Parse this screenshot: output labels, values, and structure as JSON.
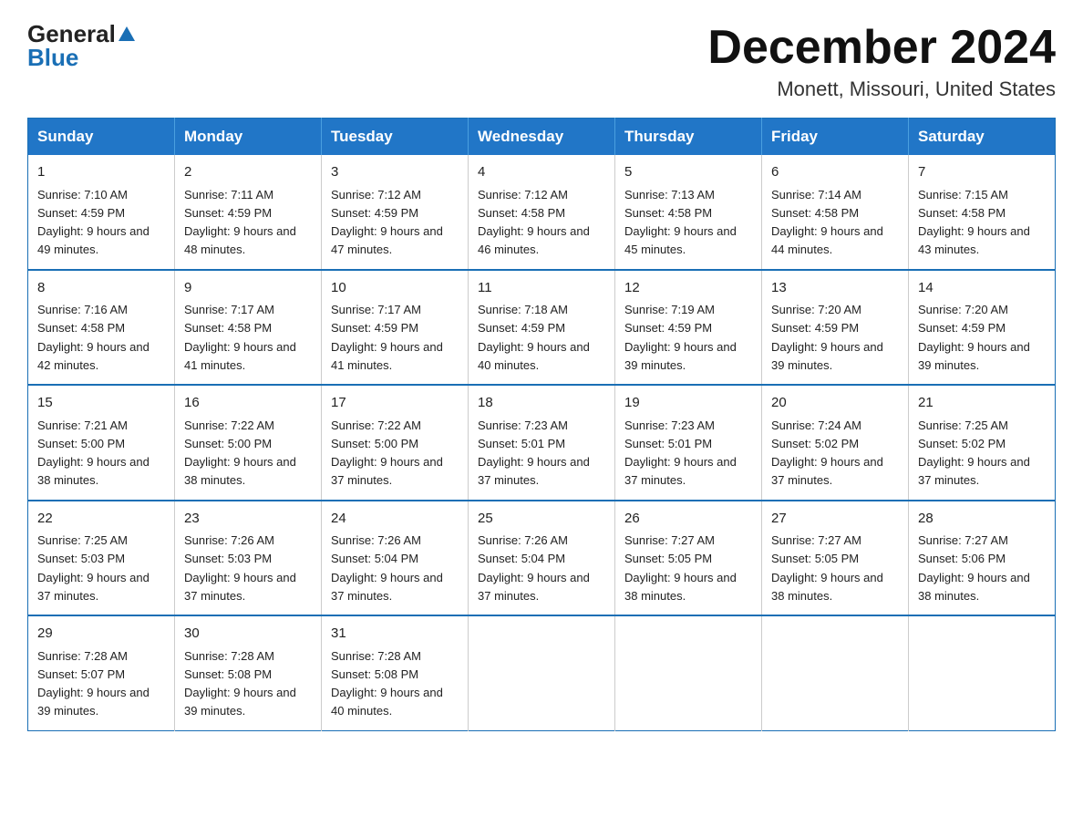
{
  "logo": {
    "general": "General",
    "blue": "Blue",
    "triangle": "▲"
  },
  "title": {
    "month_year": "December 2024",
    "location": "Monett, Missouri, United States"
  },
  "days_of_week": [
    "Sunday",
    "Monday",
    "Tuesday",
    "Wednesday",
    "Thursday",
    "Friday",
    "Saturday"
  ],
  "weeks": [
    [
      {
        "day": "1",
        "sunrise": "7:10 AM",
        "sunset": "4:59 PM",
        "daylight": "9 hours and 49 minutes."
      },
      {
        "day": "2",
        "sunrise": "7:11 AM",
        "sunset": "4:59 PM",
        "daylight": "9 hours and 48 minutes."
      },
      {
        "day": "3",
        "sunrise": "7:12 AM",
        "sunset": "4:59 PM",
        "daylight": "9 hours and 47 minutes."
      },
      {
        "day": "4",
        "sunrise": "7:12 AM",
        "sunset": "4:58 PM",
        "daylight": "9 hours and 46 minutes."
      },
      {
        "day": "5",
        "sunrise": "7:13 AM",
        "sunset": "4:58 PM",
        "daylight": "9 hours and 45 minutes."
      },
      {
        "day": "6",
        "sunrise": "7:14 AM",
        "sunset": "4:58 PM",
        "daylight": "9 hours and 44 minutes."
      },
      {
        "day": "7",
        "sunrise": "7:15 AM",
        "sunset": "4:58 PM",
        "daylight": "9 hours and 43 minutes."
      }
    ],
    [
      {
        "day": "8",
        "sunrise": "7:16 AM",
        "sunset": "4:58 PM",
        "daylight": "9 hours and 42 minutes."
      },
      {
        "day": "9",
        "sunrise": "7:17 AM",
        "sunset": "4:58 PM",
        "daylight": "9 hours and 41 minutes."
      },
      {
        "day": "10",
        "sunrise": "7:17 AM",
        "sunset": "4:59 PM",
        "daylight": "9 hours and 41 minutes."
      },
      {
        "day": "11",
        "sunrise": "7:18 AM",
        "sunset": "4:59 PM",
        "daylight": "9 hours and 40 minutes."
      },
      {
        "day": "12",
        "sunrise": "7:19 AM",
        "sunset": "4:59 PM",
        "daylight": "9 hours and 39 minutes."
      },
      {
        "day": "13",
        "sunrise": "7:20 AM",
        "sunset": "4:59 PM",
        "daylight": "9 hours and 39 minutes."
      },
      {
        "day": "14",
        "sunrise": "7:20 AM",
        "sunset": "4:59 PM",
        "daylight": "9 hours and 39 minutes."
      }
    ],
    [
      {
        "day": "15",
        "sunrise": "7:21 AM",
        "sunset": "5:00 PM",
        "daylight": "9 hours and 38 minutes."
      },
      {
        "day": "16",
        "sunrise": "7:22 AM",
        "sunset": "5:00 PM",
        "daylight": "9 hours and 38 minutes."
      },
      {
        "day": "17",
        "sunrise": "7:22 AM",
        "sunset": "5:00 PM",
        "daylight": "9 hours and 37 minutes."
      },
      {
        "day": "18",
        "sunrise": "7:23 AM",
        "sunset": "5:01 PM",
        "daylight": "9 hours and 37 minutes."
      },
      {
        "day": "19",
        "sunrise": "7:23 AM",
        "sunset": "5:01 PM",
        "daylight": "9 hours and 37 minutes."
      },
      {
        "day": "20",
        "sunrise": "7:24 AM",
        "sunset": "5:02 PM",
        "daylight": "9 hours and 37 minutes."
      },
      {
        "day": "21",
        "sunrise": "7:25 AM",
        "sunset": "5:02 PM",
        "daylight": "9 hours and 37 minutes."
      }
    ],
    [
      {
        "day": "22",
        "sunrise": "7:25 AM",
        "sunset": "5:03 PM",
        "daylight": "9 hours and 37 minutes."
      },
      {
        "day": "23",
        "sunrise": "7:26 AM",
        "sunset": "5:03 PM",
        "daylight": "9 hours and 37 minutes."
      },
      {
        "day": "24",
        "sunrise": "7:26 AM",
        "sunset": "5:04 PM",
        "daylight": "9 hours and 37 minutes."
      },
      {
        "day": "25",
        "sunrise": "7:26 AM",
        "sunset": "5:04 PM",
        "daylight": "9 hours and 37 minutes."
      },
      {
        "day": "26",
        "sunrise": "7:27 AM",
        "sunset": "5:05 PM",
        "daylight": "9 hours and 38 minutes."
      },
      {
        "day": "27",
        "sunrise": "7:27 AM",
        "sunset": "5:05 PM",
        "daylight": "9 hours and 38 minutes."
      },
      {
        "day": "28",
        "sunrise": "7:27 AM",
        "sunset": "5:06 PM",
        "daylight": "9 hours and 38 minutes."
      }
    ],
    [
      {
        "day": "29",
        "sunrise": "7:28 AM",
        "sunset": "5:07 PM",
        "daylight": "9 hours and 39 minutes."
      },
      {
        "day": "30",
        "sunrise": "7:28 AM",
        "sunset": "5:08 PM",
        "daylight": "9 hours and 39 minutes."
      },
      {
        "day": "31",
        "sunrise": "7:28 AM",
        "sunset": "5:08 PM",
        "daylight": "9 hours and 40 minutes."
      },
      null,
      null,
      null,
      null
    ]
  ]
}
